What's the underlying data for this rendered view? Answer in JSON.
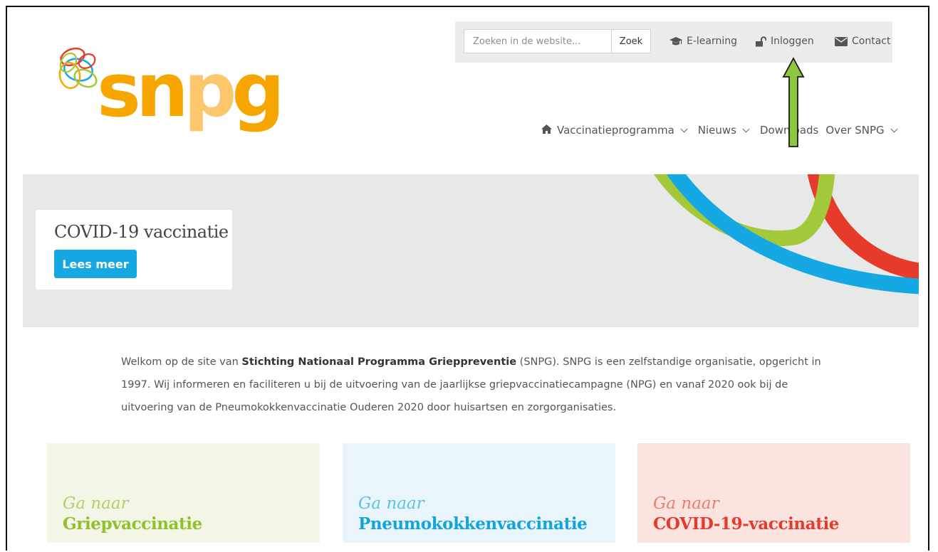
{
  "search": {
    "placeholder": "Zoeken in de website...",
    "button_label": "Zoek"
  },
  "utility_links": [
    {
      "label": "E-learning",
      "icon": "graduation-cap-icon"
    },
    {
      "label": "Inloggen",
      "icon": "unlock-icon"
    },
    {
      "label": "Contact",
      "icon": "envelope-icon"
    }
  ],
  "logo": {
    "text": "snpg",
    "alt": "SNPG",
    "color": "#f7a600"
  },
  "nav": [
    {
      "label": "Vaccinatieprogramma",
      "icon": "home-icon",
      "has_dropdown": true
    },
    {
      "label": "Nieuws",
      "has_dropdown": true
    },
    {
      "label": "Downloads",
      "has_dropdown": false
    },
    {
      "label": "Over SNPG",
      "has_dropdown": true
    }
  ],
  "hero": {
    "card_title": "COVID-19 vaccinatie",
    "button_label": "Lees meer",
    "background": "#e7e9e9",
    "button_color": "#15a8e3",
    "swoosh_colors": [
      "#a3c93a",
      "#15a8e3",
      "#e63b2b"
    ]
  },
  "intro": {
    "prefix": "Welkom op de site van ",
    "org_name": "Stichting Nationaal Programma Grieppreventie",
    "suffix": " (SNPG). SNPG is een zelfstandige organisatie, opgericht in 1997. Wij informeren en faciliteren u bij de uitvoering van de jaarlijkse griepvaccinatiecampagne (NPG) en vanaf 2020 ook bij de uitvoering van de Pneumokokkenvaccinatie Ouderen 2020 door huisartsen en zorgorganisaties."
  },
  "tiles": [
    {
      "subtitle": "Ga naar",
      "title": "Griepvaccinatie",
      "bg": "#f1f6e6",
      "color": "#93bf2b"
    },
    {
      "subtitle": "Ga naar",
      "title": "Pneumokokkenvaccinatie",
      "bg": "#e9f5fb",
      "color": "#13a4de"
    },
    {
      "subtitle": "Ga naar",
      "title": "COVID-19-vaccinatie",
      "bg": "#fbe4df",
      "color": "#e63b2b"
    }
  ],
  "annotation": {
    "arrow_color": "#8dc63f",
    "target": "Inloggen"
  }
}
